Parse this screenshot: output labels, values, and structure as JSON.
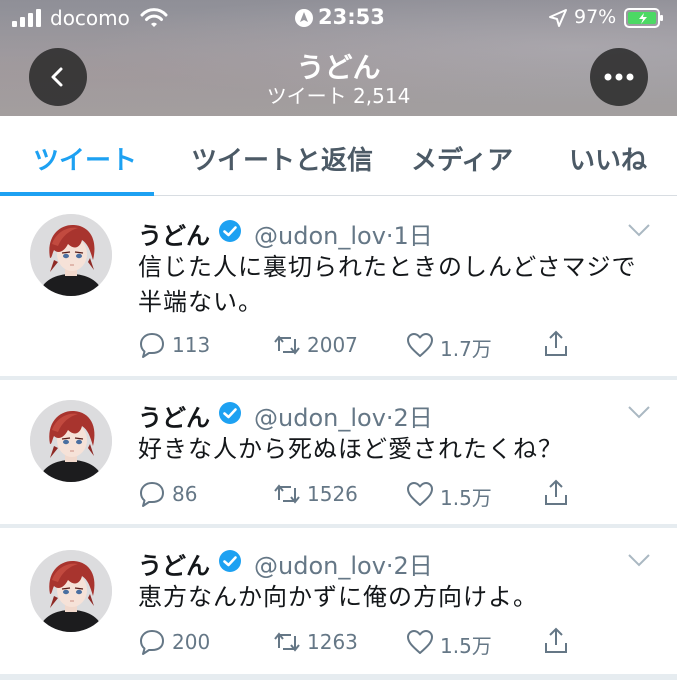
{
  "status_bar": {
    "carrier": "docomo",
    "time": "23:53",
    "battery": "97%"
  },
  "header": {
    "title": "うどん",
    "subtitle": "ツイート 2,514"
  },
  "tabs": [
    {
      "label": "ツイート",
      "active": true
    },
    {
      "label": "ツイートと返信",
      "active": false
    },
    {
      "label": "メディア",
      "active": false
    },
    {
      "label": "いいね",
      "active": false
    }
  ],
  "tweets": [
    {
      "name": "うどん",
      "handle": "@udon_lov",
      "time": "·1日",
      "text": "信じた人に裏切られたときのしんどさマジで半端ない。",
      "replies": "113",
      "retweets": "2007",
      "likes": "1.7万"
    },
    {
      "name": "うどん",
      "handle": "@udon_lov",
      "time": "·2日",
      "text": "好きな人から死ぬほど愛されたくね？",
      "replies": "86",
      "retweets": "1526",
      "likes": "1.5万"
    },
    {
      "name": "うどん",
      "handle": "@udon_lov",
      "time": "·2日",
      "text": "恵方なんか向かずに俺の方向けよ。",
      "replies": "200",
      "retweets": "1263",
      "likes": "1.5万"
    }
  ],
  "colors": {
    "accent": "#1da1f2",
    "verified": "#1da1f2",
    "text_primary": "#14171a",
    "text_secondary": "#657786"
  },
  "icons": {
    "back": "chevron-left-icon",
    "more": "more-dots-icon",
    "reply": "reply-icon",
    "retweet": "retweet-icon",
    "like": "heart-icon",
    "share": "share-icon",
    "verified": "verified-badge-icon"
  }
}
